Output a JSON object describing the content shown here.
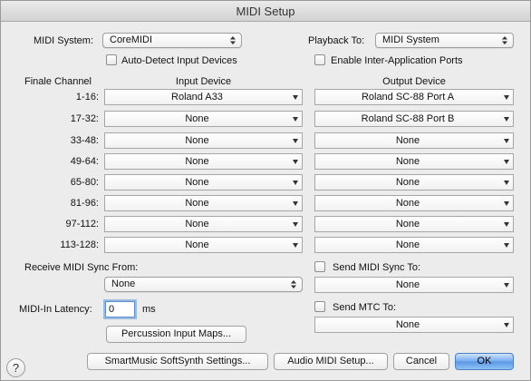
{
  "window": {
    "title": "MIDI Setup"
  },
  "midi_system": {
    "label": "MIDI System:",
    "value": "CoreMIDI"
  },
  "playback_to": {
    "label": "Playback To:",
    "value": "MIDI System"
  },
  "auto_detect": {
    "label": "Auto-Detect Input Devices",
    "checked": false
  },
  "inter_app": {
    "label": "Enable Inter-Application Ports",
    "checked": false
  },
  "grid": {
    "channel_header": "Finale Channel",
    "input_header": "Input Device",
    "output_header": "Output Device",
    "rows": [
      {
        "channel": "1-16:",
        "input": "Roland A33",
        "output": "Roland SC-88 Port A"
      },
      {
        "channel": "17-32:",
        "input": "None",
        "output": "Roland SC-88 Port B"
      },
      {
        "channel": "33-48:",
        "input": "None",
        "output": "None"
      },
      {
        "channel": "49-64:",
        "input": "None",
        "output": "None"
      },
      {
        "channel": "65-80:",
        "input": "None",
        "output": "None"
      },
      {
        "channel": "81-96:",
        "input": "None",
        "output": "None"
      },
      {
        "channel": "97-112:",
        "input": "None",
        "output": "None"
      },
      {
        "channel": "113-128:",
        "input": "None",
        "output": "None"
      }
    ]
  },
  "receive_sync": {
    "label": "Receive MIDI Sync From:",
    "value": "None"
  },
  "send_sync": {
    "label": "Send MIDI Sync To:",
    "value": "None",
    "checked": false
  },
  "send_mtc": {
    "label": "Send MTC To:",
    "value": "None",
    "checked": false
  },
  "latency": {
    "label": "MIDI-In Latency:",
    "value": "0",
    "unit": "ms"
  },
  "buttons": {
    "percussion": "Percussion Input Maps...",
    "smartmusic": "SmartMusic SoftSynth Settings...",
    "audio_midi": "Audio MIDI Setup...",
    "cancel": "Cancel",
    "ok": "OK"
  },
  "help": {
    "glyph": "?"
  }
}
